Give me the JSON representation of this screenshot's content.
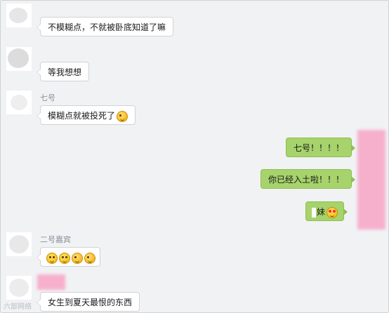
{
  "messages_left": [
    {
      "text": "不模糊点，不就被卧底知道了嘛"
    },
    {
      "sender": "",
      "text": "等我想想"
    },
    {
      "sender": "七号",
      "text": "模糊点就被投死了",
      "emoji": "wink-emoji"
    },
    {
      "sender": "二号嘉宾",
      "text": "",
      "emoji": "grin-grin-wink-wink-emoji"
    },
    {
      "sender": "",
      "text": "女生到夏天最恨的东西"
    }
  ],
  "messages_right": [
    {
      "text": "七号！！！！"
    },
    {
      "text": "你已经入土啦！！！"
    },
    {
      "text": "妹",
      "emoji": "heart-eyes-emoji"
    }
  ],
  "watermark": "六部网络",
  "colors": {
    "background": "#f1f2f4",
    "left_bubble": "#ffffff",
    "right_bubble": "#a6d36b",
    "redaction_pink": "#f7a9c7"
  }
}
